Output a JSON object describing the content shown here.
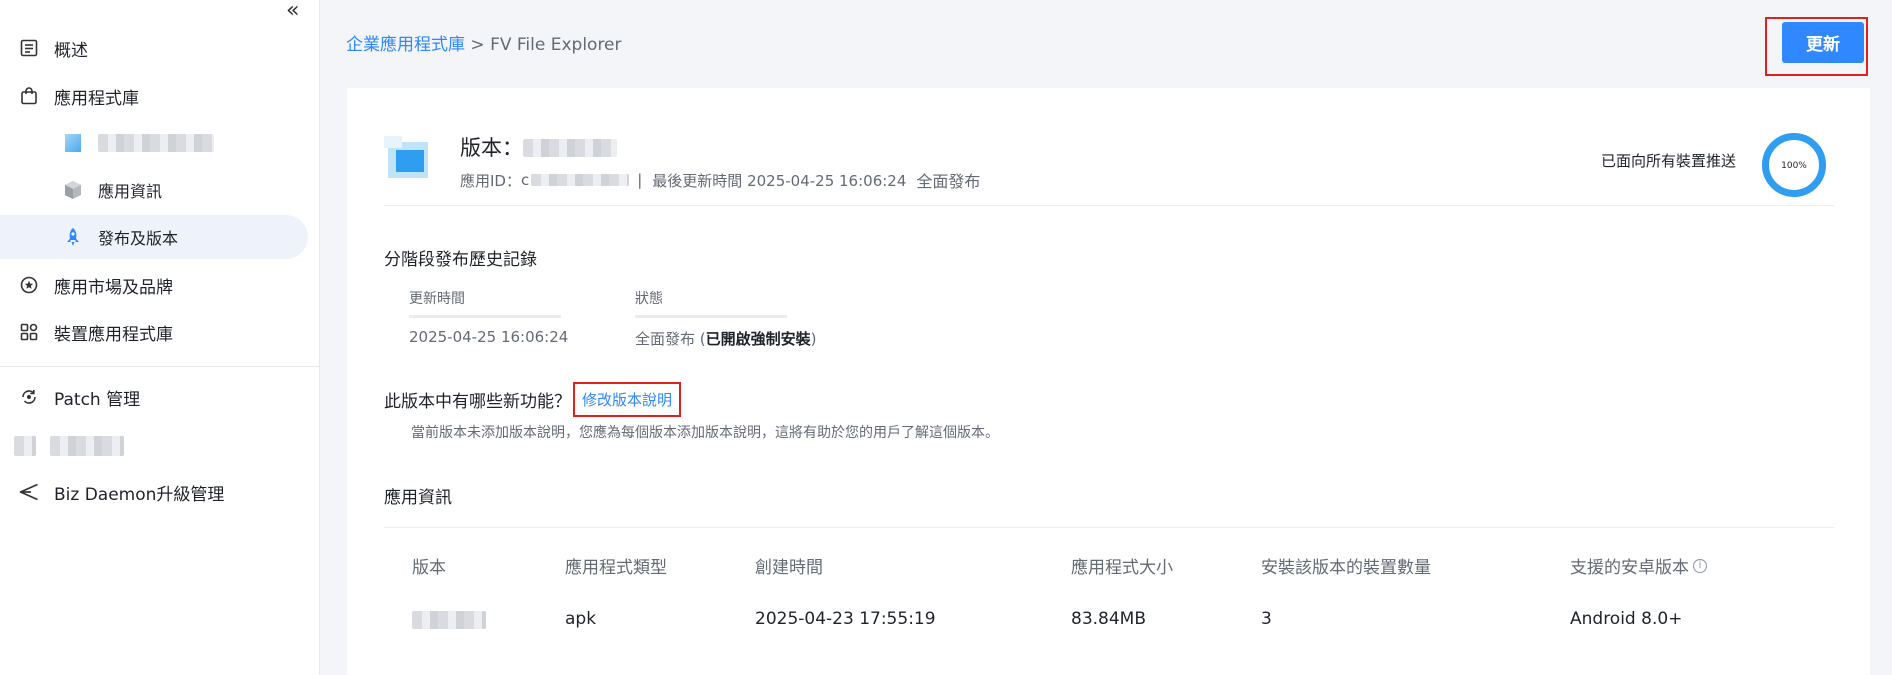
{
  "sidebar": {
    "items": [
      {
        "label": "概述",
        "icon": "overview-icon"
      },
      {
        "label": "應用程式庫",
        "icon": "bag-icon"
      },
      {
        "label": "應用資訊",
        "icon": "cube-icon"
      },
      {
        "label": "發布及版本",
        "icon": "rocket-icon"
      },
      {
        "label": "應用市場及品牌",
        "icon": "star-circle-icon"
      },
      {
        "label": "裝置應用程式庫",
        "icon": "apps-grid-icon"
      },
      {
        "label": "Patch 管理",
        "icon": "patch-icon"
      },
      {
        "label": "Biz Daemon升級管理",
        "icon": "send-icon"
      }
    ]
  },
  "breadcrumb": {
    "link": "企業應用程式庫",
    "sep": " > ",
    "current": "FV File Explorer"
  },
  "header": {
    "update_label": "更新"
  },
  "app": {
    "version_prefix": "版本：",
    "id_prefix": "應用ID：",
    "id_visible": "c",
    "meta_sep": "|",
    "last_update_label": "最後更新時間 2025-04-25 16:06:24",
    "release_status": "全面發布",
    "pushed_label": "已面向所有裝置推送",
    "progress": {
      "percent": 100,
      "label": "100%",
      "color": "#2f9df0"
    }
  },
  "history": {
    "title": "分階段發布歷史記錄",
    "col_time": "更新時間",
    "col_status": "狀態",
    "time_value": "2025-04-25 16:06:24",
    "status_value": "全面發布",
    "status_paren_open": " (",
    "status_bold": "已開啟強制安裝",
    "status_paren_close": ")"
  },
  "whatsnew": {
    "title": "此版本中有哪些新功能？",
    "edit_link": "修改版本說明",
    "hint": "當前版本未添加版本說明，您應為每個版本添加版本說明，這將有助於您的用戶了解這個版本。"
  },
  "appinfo": {
    "title": "應用資訊",
    "headers": [
      "版本",
      "應用程式類型",
      "創建時間",
      "應用程式大小",
      "安裝該版本的裝置數量",
      "支援的安卓版本"
    ],
    "row": {
      "type": "apk",
      "created": "2025-04-23 17:55:19",
      "size": "83.84MB",
      "devices": "3",
      "android": "Android 8.0+"
    }
  },
  "colors": {
    "accent": "#2f88ff",
    "highlight_border": "#e02020"
  }
}
